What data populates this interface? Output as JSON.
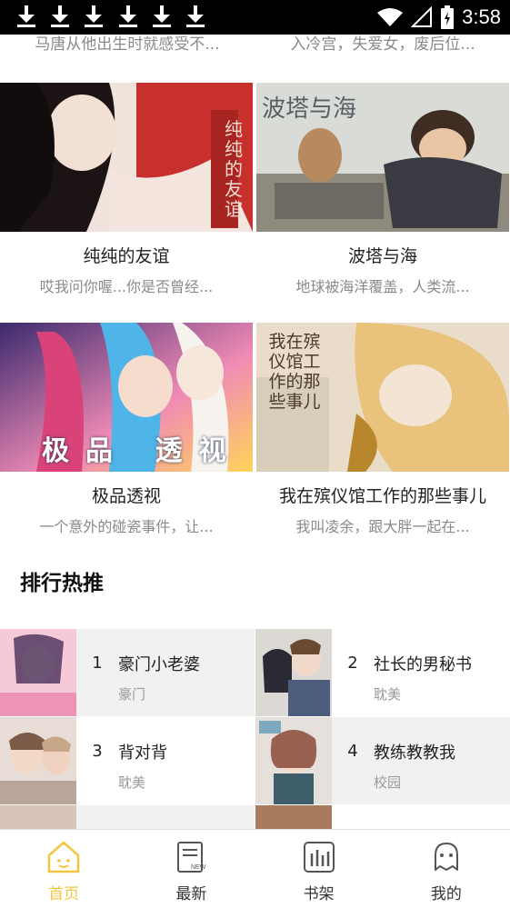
{
  "status_bar": {
    "time": "3:58",
    "download_icons": 6
  },
  "cut_row": [
    {
      "desc": "马唐从他出生时就感受不..."
    },
    {
      "desc": "入冷宫，失爱女，废后位..."
    }
  ],
  "cards": [
    {
      "title": "纯纯的友谊",
      "desc": "哎我问你喔...你是否曾经...",
      "cover_text": "纯纯的友谊"
    },
    {
      "title": "波塔与海",
      "desc": "地球被海洋覆盖，人类流...",
      "cover_text": "波塔与海"
    },
    {
      "title": "极品透视",
      "desc": "一个意外的碰瓷事件，让...",
      "cover_text": "极品 透视"
    },
    {
      "title": "我在殡仪馆工作的那些事儿",
      "desc": "我叫凌余，跟大胖一起在...",
      "cover_text": "我在殡仪馆工作的那些事儿"
    }
  ],
  "ranking": {
    "title": "排行热推",
    "items": [
      {
        "num": "1",
        "name": "豪门小老婆",
        "tag": "豪门"
      },
      {
        "num": "2",
        "name": "社长的男秘书",
        "tag": "耽美"
      },
      {
        "num": "3",
        "name": "背对背",
        "tag": "耽美"
      },
      {
        "num": "4",
        "name": "教练教教我",
        "tag": "校园"
      }
    ]
  },
  "nav": {
    "active_color": "#f5c542",
    "items": [
      {
        "label": "首页",
        "icon": "home-icon"
      },
      {
        "label": "最新",
        "icon": "new-icon"
      },
      {
        "label": "书架",
        "icon": "bookshelf-icon"
      },
      {
        "label": "我的",
        "icon": "ghost-icon"
      }
    ]
  }
}
